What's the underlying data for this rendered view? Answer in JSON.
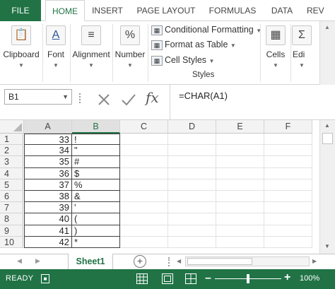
{
  "ribbon_tabs": [
    "FILE",
    "HOME",
    "INSERT",
    "PAGE LAYOUT",
    "FORMULAS",
    "DATA",
    "REV"
  ],
  "groups": {
    "clipboard": "Clipboard",
    "font": "Font",
    "alignment": "Alignment",
    "number": "Number",
    "number_symbol": "%",
    "font_symbol": "A",
    "cells": "Cells",
    "editing": "Edi"
  },
  "styles": {
    "conditional": "Conditional Formatting",
    "format_table": "Format as Table",
    "cell_styles": "Cell Styles",
    "group": "Styles"
  },
  "formula_bar": {
    "name_box": "B1",
    "fx": "fx",
    "formula": "=CHAR(A1)"
  },
  "columns": [
    "A",
    "B",
    "C",
    "D",
    "E",
    "F"
  ],
  "rows": [
    {
      "n": "1",
      "a": "33",
      "b": "!"
    },
    {
      "n": "2",
      "a": "34",
      "b": "\""
    },
    {
      "n": "3",
      "a": "35",
      "b": "#"
    },
    {
      "n": "4",
      "a": "36",
      "b": "$"
    },
    {
      "n": "5",
      "a": "37",
      "b": "%"
    },
    {
      "n": "6",
      "a": "38",
      "b": "&"
    },
    {
      "n": "7",
      "a": "39",
      "b": "'"
    },
    {
      "n": "8",
      "a": "40",
      "b": "("
    },
    {
      "n": "9",
      "a": "41",
      "b": ")"
    },
    {
      "n": "10",
      "a": "42",
      "b": "*"
    }
  ],
  "sheet": {
    "active": "Sheet1",
    "add": "+"
  },
  "status": {
    "ready": "READY",
    "zoom": "100%"
  },
  "colors": {
    "excel_green": "#217346"
  }
}
